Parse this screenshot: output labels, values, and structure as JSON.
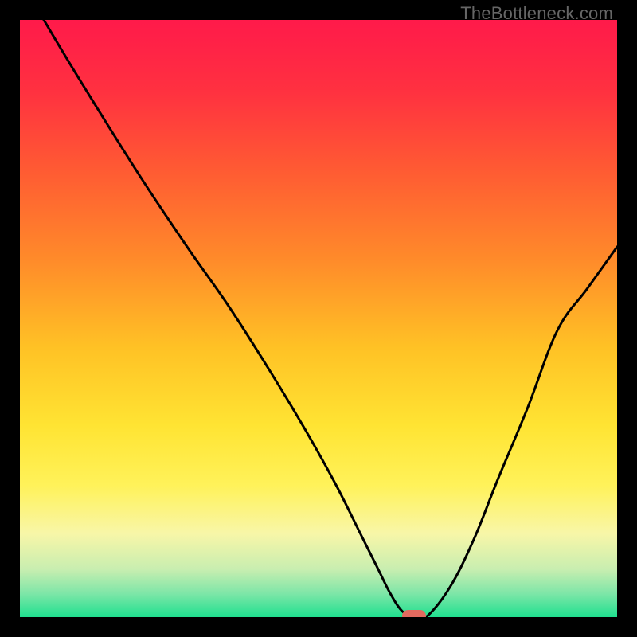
{
  "attribution": "TheBottleneck.com",
  "colors": {
    "black": "#000000",
    "curve": "#000000",
    "marker": "#e26a5f",
    "gradient_stops": [
      {
        "offset": 0.0,
        "color": "#ff1a4a"
      },
      {
        "offset": 0.12,
        "color": "#ff3140"
      },
      {
        "offset": 0.25,
        "color": "#ff5a33"
      },
      {
        "offset": 0.4,
        "color": "#ff8a2a"
      },
      {
        "offset": 0.55,
        "color": "#ffc225"
      },
      {
        "offset": 0.68,
        "color": "#ffe433"
      },
      {
        "offset": 0.78,
        "color": "#fff25a"
      },
      {
        "offset": 0.86,
        "color": "#f8f6a8"
      },
      {
        "offset": 0.92,
        "color": "#c8eeb0"
      },
      {
        "offset": 0.96,
        "color": "#7fe6a8"
      },
      {
        "offset": 1.0,
        "color": "#1fe08f"
      }
    ]
  },
  "chart_data": {
    "type": "line",
    "title": "",
    "xlabel": "",
    "ylabel": "",
    "xlim": [
      0,
      100
    ],
    "ylim": [
      0,
      100
    ],
    "grid": false,
    "legend": false,
    "series": [
      {
        "name": "bottleneck-curve",
        "x": [
          4,
          10,
          20,
          28,
          35,
          42,
          48,
          53,
          57,
          60,
          62,
          64,
          66,
          68,
          72,
          76,
          80,
          85,
          90,
          95,
          100
        ],
        "y": [
          100,
          90,
          74,
          62,
          52,
          41,
          31,
          22,
          14,
          8,
          4,
          1,
          0,
          0,
          5,
          13,
          23,
          35,
          48,
          55,
          62
        ]
      }
    ],
    "marker": {
      "x": 66,
      "y": 0,
      "w": 4,
      "h": 2
    },
    "notes": "y represents bottleneck percentage (0 = no bottleneck / green, 100 = severe / red). Curve reaches minimum (~0) near x≈66 where the marker sits; left branch starts near top-left, right branch rises toward upper-right. Values estimated from pixel positions; axes unlabeled in source."
  }
}
